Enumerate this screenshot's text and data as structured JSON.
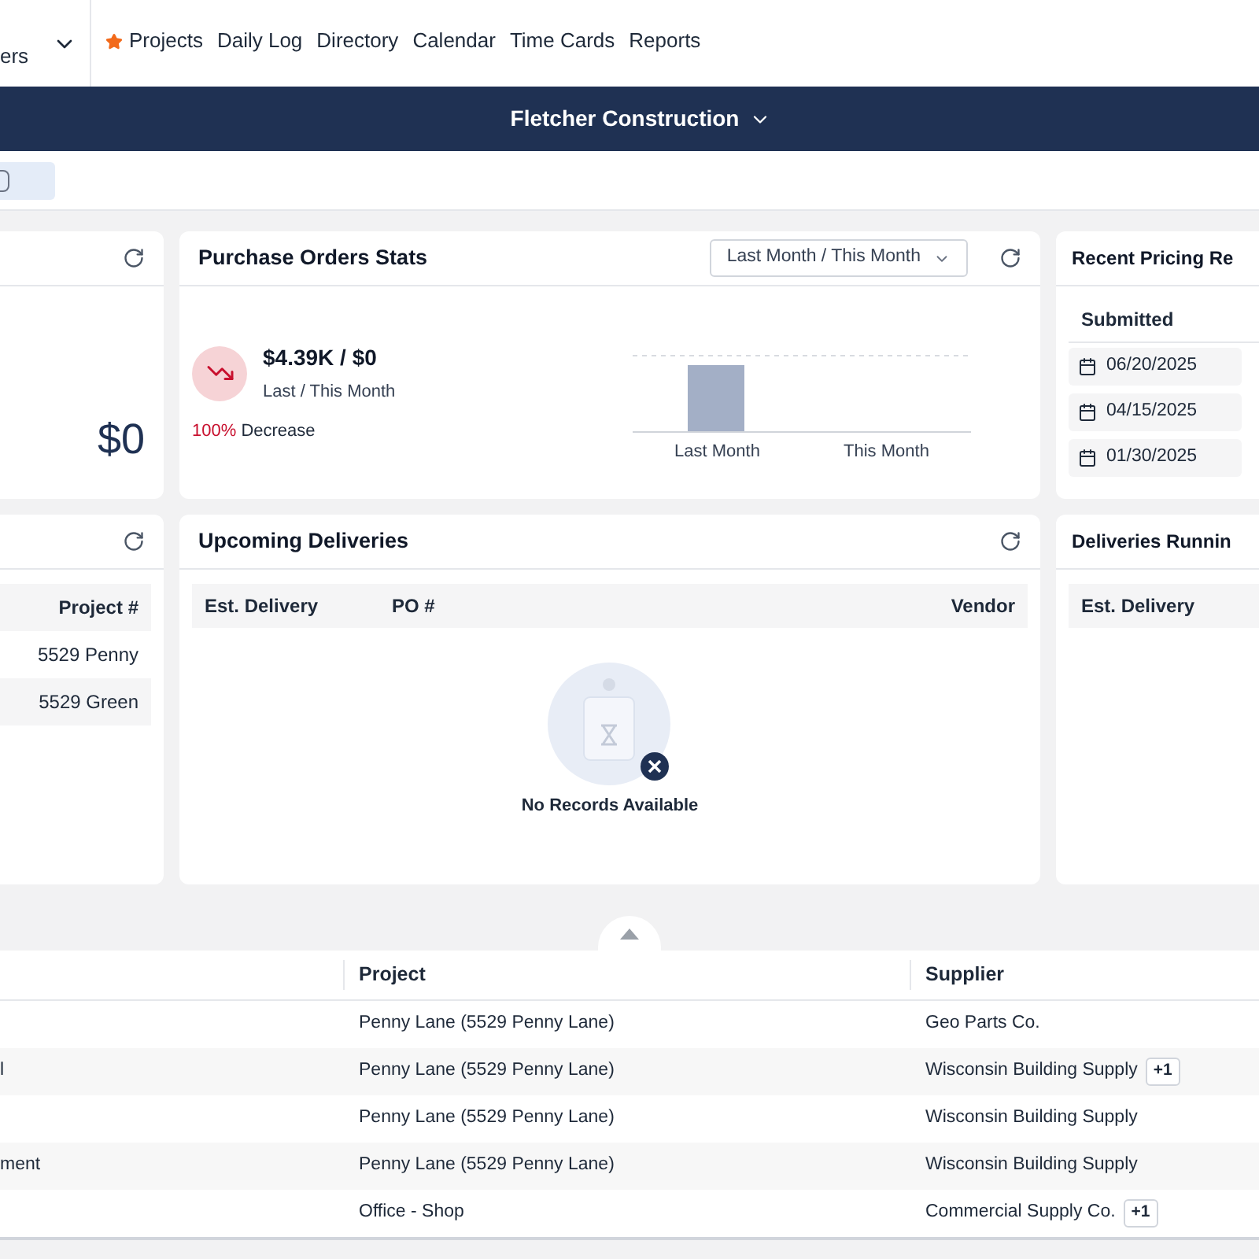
{
  "nav": {
    "switcher_label": "ers",
    "links": [
      {
        "label": "Projects",
        "starred": true
      },
      {
        "label": "Daily Log",
        "starred": false
      },
      {
        "label": "Directory",
        "starred": false
      },
      {
        "label": "Calendar",
        "starred": false
      },
      {
        "label": "Time Cards",
        "starred": false
      },
      {
        "label": "Reports",
        "starred": false
      }
    ]
  },
  "banner": {
    "company": "Fletcher Construction"
  },
  "summary_card": {
    "amount": "$0"
  },
  "purchase_orders_stats": {
    "title": "Purchase Orders Stats",
    "period_select": "Last Month / This Month",
    "amount": "$4.39K / $0",
    "caption": "Last / This Month",
    "change_pct": "100%",
    "change_label": "Decrease",
    "x_labels": [
      "Last Month",
      "This Month"
    ]
  },
  "recent_pricing": {
    "title": "Recent Pricing Re",
    "column": "Submitted",
    "dates": [
      "06/20/2025",
      "04/15/2025",
      "01/30/2025"
    ]
  },
  "projects_card": {
    "column": "Project #",
    "rows": [
      "5529 Penny",
      "5529 Green"
    ]
  },
  "upcoming_deliveries": {
    "title": "Upcoming Deliveries",
    "columns": [
      "Est. Delivery",
      "PO #",
      "Vendor"
    ],
    "empty_text": "No Records Available"
  },
  "deliveries_running": {
    "title": "Deliveries Runnin",
    "columns": [
      "Est. Delivery"
    ]
  },
  "table": {
    "columns": [
      "Project",
      "Supplier"
    ],
    "rows": [
      {
        "project": "Penny Lane (5529 Penny Lane)",
        "supplier": "Geo Parts Co."
      },
      {
        "column_1": "l",
        "project": "Penny Lane (5529 Penny Lane)",
        "supplier": "Wisconsin Building Supply",
        "extra": "+1"
      },
      {
        "project": "Penny Lane (5529 Penny Lane)",
        "supplier": "Wisconsin Building Supply"
      },
      {
        "column_1": "ment",
        "project": "Penny Lane (5529 Penny Lane)",
        "supplier": "Wisconsin Building Supply"
      },
      {
        "project": "Office - Shop",
        "supplier": "Commercial Supply Co.",
        "extra": "+1"
      }
    ]
  }
}
